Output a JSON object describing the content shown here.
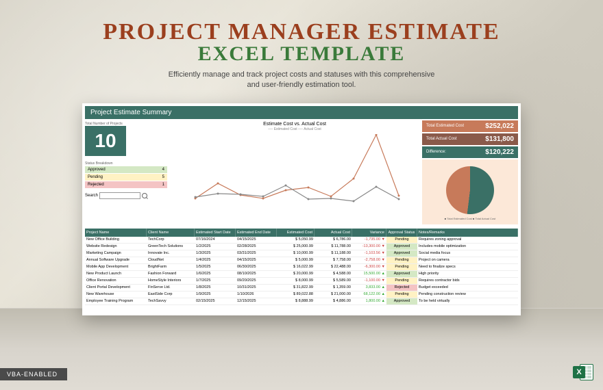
{
  "header": {
    "title1": "PROJECT MANAGER ESTIMATE",
    "title2": "EXCEL TEMPLATE",
    "subtitle": "Efficiently manage and track project costs and statuses with this comprehensive\nand user-friendly estimation tool."
  },
  "badges": {
    "vba": "VBA-ENABLED",
    "excel": "X"
  },
  "sheet": {
    "banner": "Project Estimate Summary",
    "count_label": "Total Number of Projects",
    "count": "10",
    "status_label": "Status Breakdown",
    "statuses": [
      {
        "name": "Approved",
        "count": "4"
      },
      {
        "name": "Pending",
        "count": "5"
      },
      {
        "name": "Rejected",
        "count": "1"
      }
    ],
    "search_label": "Search",
    "chart_title": "Estimate Cost vs. Actual Cost",
    "legend": "── Estimated Cost    ── Actual Cost",
    "kpis": [
      {
        "label": "Total Estimated Cost",
        "value": "$252,022"
      },
      {
        "label": "Total Actual Cost",
        "value": "$131,800"
      },
      {
        "label": "Difference:",
        "value": "$120,222"
      }
    ],
    "pie_legend": "■ Total Estimated Cost   ■ Total Actual Cost",
    "columns": [
      "Project Name",
      "Client Name",
      "Estimated Start Date",
      "Estimated End Date",
      "Estimated Cost",
      "Actual Cost",
      "Variance",
      "Approval Status",
      "Notes/Remarks"
    ],
    "rows": [
      {
        "proj": "New Office Building",
        "client": "TechCorp",
        "sd": "07/16/2024",
        "ed": "04/15/2025",
        "ec": "5,050.99",
        "ac": "6,786.00",
        "var": "-1,735.00",
        "dir": "dn",
        "stat": "Pending",
        "badge": "badge-pen",
        "notes": "Requires zoning approval"
      },
      {
        "proj": "Website Redesign",
        "client": "GreenTech Solutions",
        "sd": "1/2/2025",
        "ed": "02/28/2025",
        "ec": "25,000.99",
        "ac": "11,788.00",
        "var": "-13,300.00",
        "dir": "dn",
        "stat": "Approved",
        "badge": "badge-app",
        "notes": "Includes mobile optimization"
      },
      {
        "proj": "Marketing Campaign",
        "client": "Innovate Inc.",
        "sd": "1/3/2025",
        "ed": "03/31/2025",
        "ec": "10,000.99",
        "ac": "11,188.00",
        "var": "-1,103.56",
        "dir": "dn",
        "stat": "Approved",
        "badge": "badge-app",
        "notes": "Social media focus"
      },
      {
        "proj": "Annual Software Upgrade",
        "client": "CloudNet",
        "sd": "1/4/2025",
        "ed": "04/15/2025",
        "ec": "5,000.99",
        "ac": "7,758.00",
        "var": "-2,758.00",
        "dir": "dn",
        "stat": "Pending",
        "badge": "badge-pen",
        "notes": "Project on camera"
      },
      {
        "proj": "Mobile App Development",
        "client": "BrightFarm",
        "sd": "1/5/2025",
        "ed": "06/30/2025",
        "ec": "16,022.99",
        "ac": "22,488.00",
        "var": "-6,300.00",
        "dir": "dn",
        "stat": "Pending",
        "badge": "badge-pen",
        "notes": "Need to finalize specs"
      },
      {
        "proj": "New Product Launch",
        "client": "Fashion Forward",
        "sd": "1/6/2025",
        "ed": "08/10/2025",
        "ec": "20,000.99",
        "ac": "4,588.00",
        "var": "15,500.00",
        "dir": "up",
        "stat": "Approved",
        "badge": "badge-app",
        "notes": "High priority"
      },
      {
        "proj": "Office Renovation",
        "client": "HomeStyle Interiors",
        "sd": "1/7/2025",
        "ed": "09/20/2025",
        "ec": "8,000.99",
        "ac": "5,589.00",
        "var": "-1,100.00",
        "dir": "dn",
        "stat": "Pending",
        "badge": "badge-pen",
        "notes": "Requires contractor bids"
      },
      {
        "proj": "Client Portal Development",
        "client": "FinServe Ltd.",
        "sd": "1/8/2025",
        "ed": "10/31/2025",
        "ec": "31,822.99",
        "ac": "1,359.00",
        "var": "3,833.00",
        "dir": "up",
        "stat": "Rejected",
        "badge": "badge-rej",
        "notes": "Budget exceeded"
      },
      {
        "proj": "New Warehouse",
        "client": "EastSide Corp",
        "sd": "1/9/2025",
        "ed": "1/10/2026",
        "ec": "89,022.88",
        "ac": "21,000.00",
        "var": "68,122.00",
        "dir": "up",
        "stat": "Pending",
        "badge": "badge-pen",
        "notes": "Pending construction review"
      },
      {
        "proj": "Employee Training Program",
        "client": "TechSavvy",
        "sd": "02/15/2025",
        "ed": "12/15/2025",
        "ec": "8,888.99",
        "ac": "4,886.00",
        "var": "1,800.00",
        "dir": "up",
        "stat": "Approved",
        "badge": "badge-app",
        "notes": "To be held virtually"
      }
    ]
  },
  "chart_data": {
    "type": "line",
    "title": "Estimate Cost vs. Actual Cost",
    "categories": [
      "New Office Building",
      "Website Redesign",
      "Marketing Campaign",
      "Annual Software Upgrade",
      "Mobile App Development",
      "New Product Launch",
      "Office Renovation",
      "Client Portal Development",
      "New Warehouse",
      "Employee Training Program"
    ],
    "series": [
      {
        "name": "Estimated Cost",
        "values": [
          5050,
          25000,
          10000,
          5000,
          16022,
          20000,
          8000,
          31822,
          89022,
          8888
        ]
      },
      {
        "name": "Actual Cost",
        "values": [
          6786,
          11788,
          11188,
          7758,
          22488,
          4588,
          5589,
          1359,
          21000,
          4886
        ]
      }
    ],
    "ylim": [
      0,
      90000
    ]
  }
}
